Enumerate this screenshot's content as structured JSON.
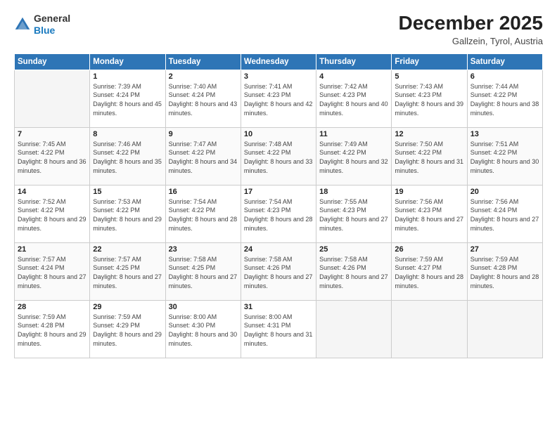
{
  "logo": {
    "general": "General",
    "blue": "Blue"
  },
  "header": {
    "month": "December 2025",
    "location": "Gallzein, Tyrol, Austria"
  },
  "weekdays": [
    "Sunday",
    "Monday",
    "Tuesday",
    "Wednesday",
    "Thursday",
    "Friday",
    "Saturday"
  ],
  "weeks": [
    [
      {
        "day": "",
        "sunrise": "",
        "sunset": "",
        "daylight": ""
      },
      {
        "day": "1",
        "sunrise": "Sunrise: 7:39 AM",
        "sunset": "Sunset: 4:24 PM",
        "daylight": "Daylight: 8 hours and 45 minutes."
      },
      {
        "day": "2",
        "sunrise": "Sunrise: 7:40 AM",
        "sunset": "Sunset: 4:24 PM",
        "daylight": "Daylight: 8 hours and 43 minutes."
      },
      {
        "day": "3",
        "sunrise": "Sunrise: 7:41 AM",
        "sunset": "Sunset: 4:23 PM",
        "daylight": "Daylight: 8 hours and 42 minutes."
      },
      {
        "day": "4",
        "sunrise": "Sunrise: 7:42 AM",
        "sunset": "Sunset: 4:23 PM",
        "daylight": "Daylight: 8 hours and 40 minutes."
      },
      {
        "day": "5",
        "sunrise": "Sunrise: 7:43 AM",
        "sunset": "Sunset: 4:23 PM",
        "daylight": "Daylight: 8 hours and 39 minutes."
      },
      {
        "day": "6",
        "sunrise": "Sunrise: 7:44 AM",
        "sunset": "Sunset: 4:22 PM",
        "daylight": "Daylight: 8 hours and 38 minutes."
      }
    ],
    [
      {
        "day": "7",
        "sunrise": "Sunrise: 7:45 AM",
        "sunset": "Sunset: 4:22 PM",
        "daylight": "Daylight: 8 hours and 36 minutes."
      },
      {
        "day": "8",
        "sunrise": "Sunrise: 7:46 AM",
        "sunset": "Sunset: 4:22 PM",
        "daylight": "Daylight: 8 hours and 35 minutes."
      },
      {
        "day": "9",
        "sunrise": "Sunrise: 7:47 AM",
        "sunset": "Sunset: 4:22 PM",
        "daylight": "Daylight: 8 hours and 34 minutes."
      },
      {
        "day": "10",
        "sunrise": "Sunrise: 7:48 AM",
        "sunset": "Sunset: 4:22 PM",
        "daylight": "Daylight: 8 hours and 33 minutes."
      },
      {
        "day": "11",
        "sunrise": "Sunrise: 7:49 AM",
        "sunset": "Sunset: 4:22 PM",
        "daylight": "Daylight: 8 hours and 32 minutes."
      },
      {
        "day": "12",
        "sunrise": "Sunrise: 7:50 AM",
        "sunset": "Sunset: 4:22 PM",
        "daylight": "Daylight: 8 hours and 31 minutes."
      },
      {
        "day": "13",
        "sunrise": "Sunrise: 7:51 AM",
        "sunset": "Sunset: 4:22 PM",
        "daylight": "Daylight: 8 hours and 30 minutes."
      }
    ],
    [
      {
        "day": "14",
        "sunrise": "Sunrise: 7:52 AM",
        "sunset": "Sunset: 4:22 PM",
        "daylight": "Daylight: 8 hours and 29 minutes."
      },
      {
        "day": "15",
        "sunrise": "Sunrise: 7:53 AM",
        "sunset": "Sunset: 4:22 PM",
        "daylight": "Daylight: 8 hours and 29 minutes."
      },
      {
        "day": "16",
        "sunrise": "Sunrise: 7:54 AM",
        "sunset": "Sunset: 4:22 PM",
        "daylight": "Daylight: 8 hours and 28 minutes."
      },
      {
        "day": "17",
        "sunrise": "Sunrise: 7:54 AM",
        "sunset": "Sunset: 4:23 PM",
        "daylight": "Daylight: 8 hours and 28 minutes."
      },
      {
        "day": "18",
        "sunrise": "Sunrise: 7:55 AM",
        "sunset": "Sunset: 4:23 PM",
        "daylight": "Daylight: 8 hours and 27 minutes."
      },
      {
        "day": "19",
        "sunrise": "Sunrise: 7:56 AM",
        "sunset": "Sunset: 4:23 PM",
        "daylight": "Daylight: 8 hours and 27 minutes."
      },
      {
        "day": "20",
        "sunrise": "Sunrise: 7:56 AM",
        "sunset": "Sunset: 4:24 PM",
        "daylight": "Daylight: 8 hours and 27 minutes."
      }
    ],
    [
      {
        "day": "21",
        "sunrise": "Sunrise: 7:57 AM",
        "sunset": "Sunset: 4:24 PM",
        "daylight": "Daylight: 8 hours and 27 minutes."
      },
      {
        "day": "22",
        "sunrise": "Sunrise: 7:57 AM",
        "sunset": "Sunset: 4:25 PM",
        "daylight": "Daylight: 8 hours and 27 minutes."
      },
      {
        "day": "23",
        "sunrise": "Sunrise: 7:58 AM",
        "sunset": "Sunset: 4:25 PM",
        "daylight": "Daylight: 8 hours and 27 minutes."
      },
      {
        "day": "24",
        "sunrise": "Sunrise: 7:58 AM",
        "sunset": "Sunset: 4:26 PM",
        "daylight": "Daylight: 8 hours and 27 minutes."
      },
      {
        "day": "25",
        "sunrise": "Sunrise: 7:58 AM",
        "sunset": "Sunset: 4:26 PM",
        "daylight": "Daylight: 8 hours and 27 minutes."
      },
      {
        "day": "26",
        "sunrise": "Sunrise: 7:59 AM",
        "sunset": "Sunset: 4:27 PM",
        "daylight": "Daylight: 8 hours and 28 minutes."
      },
      {
        "day": "27",
        "sunrise": "Sunrise: 7:59 AM",
        "sunset": "Sunset: 4:28 PM",
        "daylight": "Daylight: 8 hours and 28 minutes."
      }
    ],
    [
      {
        "day": "28",
        "sunrise": "Sunrise: 7:59 AM",
        "sunset": "Sunset: 4:28 PM",
        "daylight": "Daylight: 8 hours and 29 minutes."
      },
      {
        "day": "29",
        "sunrise": "Sunrise: 7:59 AM",
        "sunset": "Sunset: 4:29 PM",
        "daylight": "Daylight: 8 hours and 29 minutes."
      },
      {
        "day": "30",
        "sunrise": "Sunrise: 8:00 AM",
        "sunset": "Sunset: 4:30 PM",
        "daylight": "Daylight: 8 hours and 30 minutes."
      },
      {
        "day": "31",
        "sunrise": "Sunrise: 8:00 AM",
        "sunset": "Sunset: 4:31 PM",
        "daylight": "Daylight: 8 hours and 31 minutes."
      },
      {
        "day": "",
        "sunrise": "",
        "sunset": "",
        "daylight": ""
      },
      {
        "day": "",
        "sunrise": "",
        "sunset": "",
        "daylight": ""
      },
      {
        "day": "",
        "sunrise": "",
        "sunset": "",
        "daylight": ""
      }
    ]
  ]
}
